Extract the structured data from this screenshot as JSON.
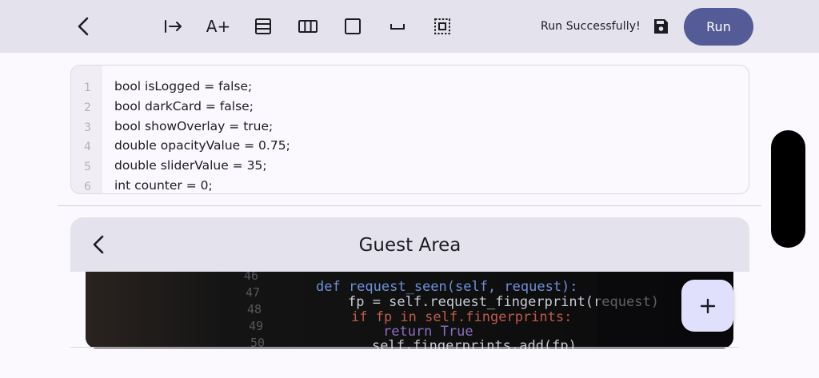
{
  "toolbar": {
    "back_icon": "chevron-left-icon",
    "tools": [
      {
        "name": "indent-arrow-icon"
      },
      {
        "name": "font-size-increase-icon",
        "label": "A+"
      },
      {
        "name": "rows-layout-icon"
      },
      {
        "name": "columns-layout-icon"
      },
      {
        "name": "container-icon"
      },
      {
        "name": "spacer-icon"
      },
      {
        "name": "padding-icon"
      }
    ],
    "status": "Run Successfully!",
    "save_icon": "floppy-disk-icon",
    "run_label": "Run"
  },
  "editor": {
    "line_numbers": [
      "1",
      "2",
      "3",
      "4",
      "5",
      "6"
    ],
    "lines": [
      "bool isLogged = false;",
      "bool darkCard = false;",
      "bool showOverlay = true;",
      "double opacityValue = 0.75;",
      "double sliderValue = 35;",
      "int counter = 0;"
    ]
  },
  "preview": {
    "title": "Guest Area",
    "back_icon": "chevron-left-icon",
    "fab_icon": "plus-icon",
    "photo": {
      "line_numbers": [
        "46",
        "47",
        "48",
        "49",
        "50"
      ],
      "code_lines": [
        "def request_seen(self, request):",
        "fp = self.request_fingerprint(request)",
        "if fp in self.fingerprints:",
        "return True",
        "self.fingerprints.add(fp)"
      ]
    }
  },
  "colors": {
    "toolbar_bg": "#e4e2ec",
    "run_button": "#545b96",
    "fab_bg": "#e1e0fc",
    "page_bg": "#fbf8fe"
  }
}
